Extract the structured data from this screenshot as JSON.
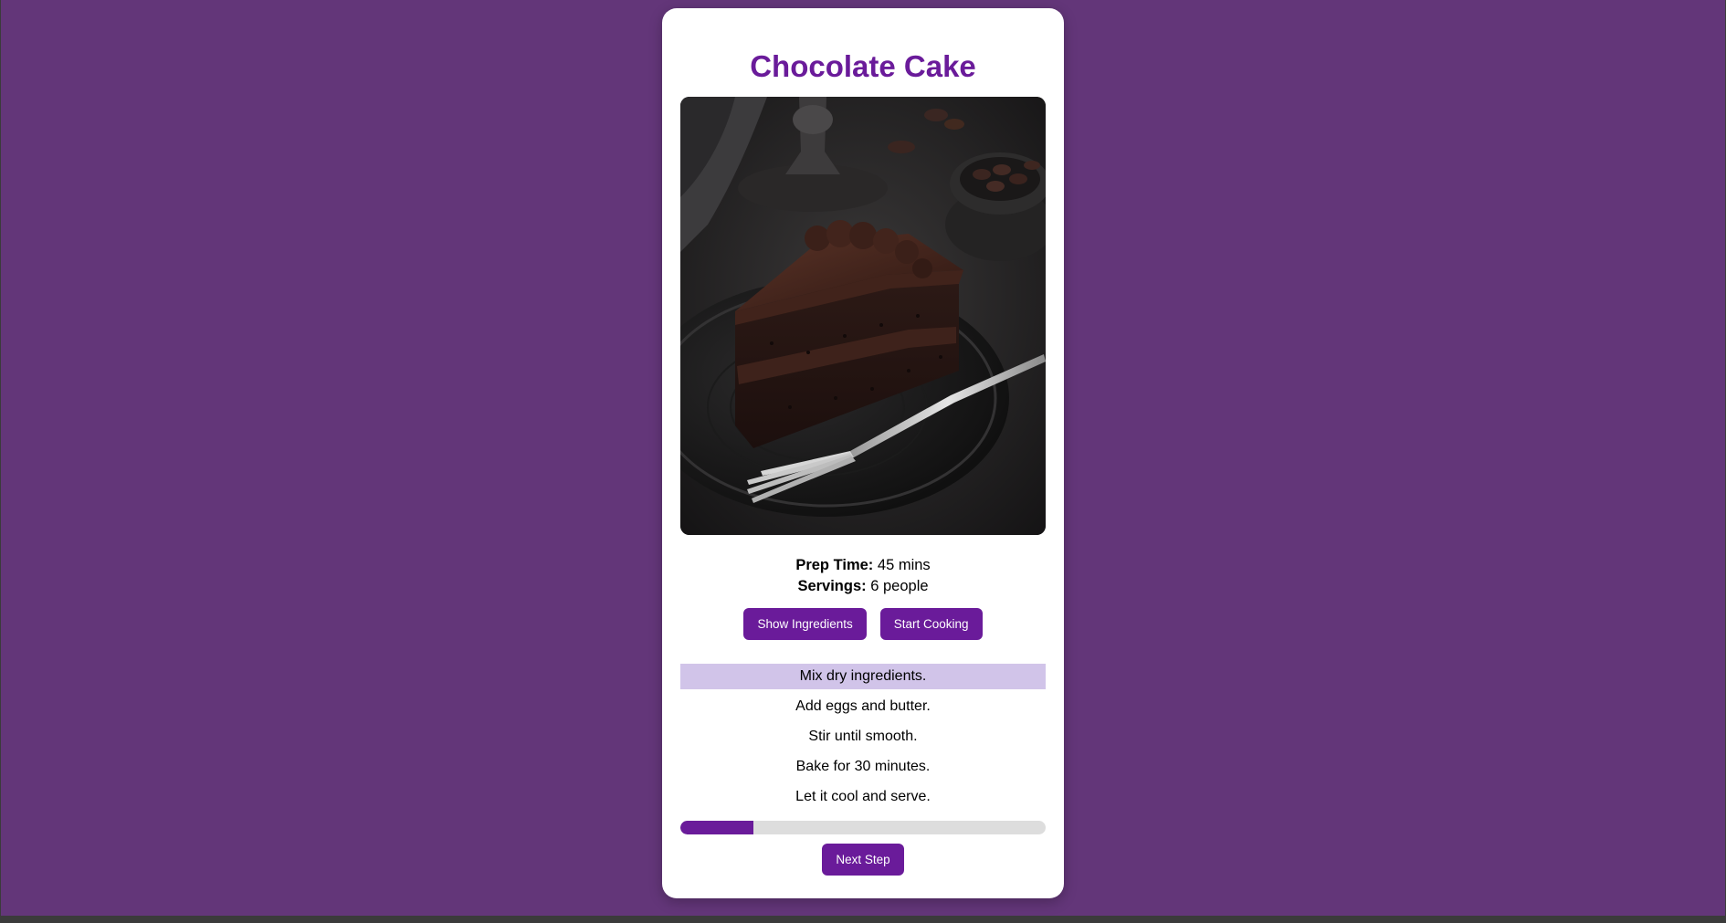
{
  "recipe": {
    "title": "Chocolate Cake",
    "prep_label": "Prep Time:",
    "prep_value": "45 mins",
    "servings_label": "Servings:",
    "servings_value": "6 people"
  },
  "actions": {
    "show_ingredients": "Show Ingredients",
    "start_cooking": "Start Cooking",
    "next_step": "Next Step"
  },
  "steps": [
    "Mix dry ingredients.",
    "Add eggs and butter.",
    "Stir until smooth.",
    "Bake for 30 minutes.",
    "Let it cool and serve."
  ],
  "current_step": 1,
  "progress": {
    "fraction": 0.2
  },
  "colors": {
    "page_background": "#633679",
    "accent": "#6a1b9a",
    "active_step": "#d1c4e9",
    "progress_track": "#dddddd"
  }
}
